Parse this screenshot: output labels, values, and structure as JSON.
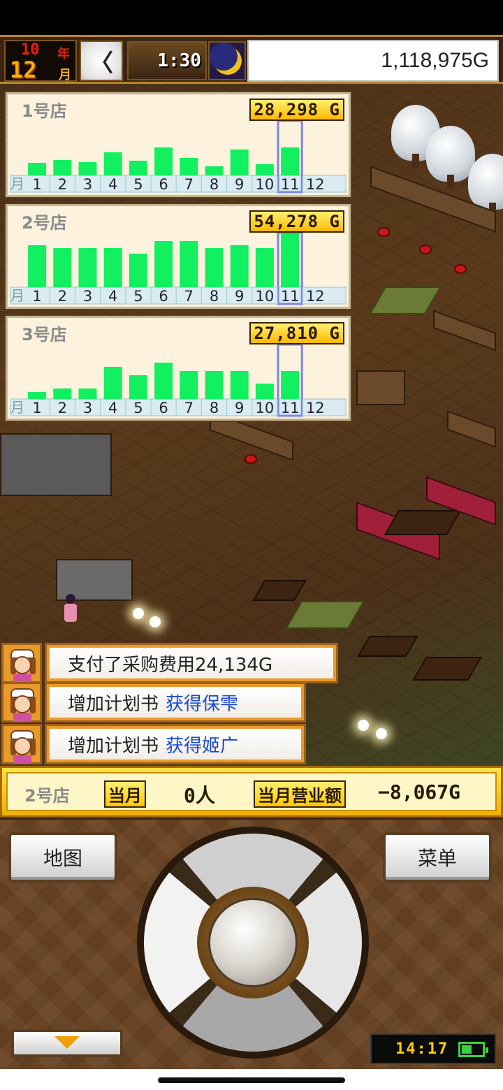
{
  "hud": {
    "year": "10",
    "year_unit": "年",
    "month": "12",
    "month_unit": "月",
    "clock_icon": "clock-back-icon",
    "clock_glyph": "〈",
    "time": "1:30",
    "moon_icon": "moon-icon",
    "money": "1,118,975G"
  },
  "chart_data": [
    {
      "type": "bar",
      "title": "1号店",
      "total": "28,298 G",
      "month_axis_label": "月",
      "categories": [
        "1",
        "2",
        "3",
        "4",
        "5",
        "6",
        "7",
        "8",
        "9",
        "10",
        "11",
        "12"
      ],
      "values": [
        18,
        22,
        19,
        33,
        21,
        40,
        25,
        13,
        37,
        16,
        40,
        null
      ],
      "highlight_index": 10,
      "bar_color": "#12f060"
    },
    {
      "type": "bar",
      "title": "2号店",
      "total": "54,278 G",
      "month_axis_label": "月",
      "categories": [
        "1",
        "2",
        "3",
        "4",
        "5",
        "6",
        "7",
        "8",
        "9",
        "10",
        "11",
        "12"
      ],
      "values": [
        60,
        56,
        56,
        56,
        48,
        66,
        66,
        56,
        60,
        56,
        78,
        null
      ],
      "highlight_index": 10,
      "bar_color": "#12f060"
    },
    {
      "type": "bar",
      "title": "3号店",
      "total": "27,810 G",
      "month_axis_label": "月",
      "categories": [
        "1",
        "2",
        "3",
        "4",
        "5",
        "6",
        "7",
        "8",
        "9",
        "10",
        "11",
        "12"
      ],
      "values": [
        10,
        15,
        15,
        46,
        34,
        52,
        40,
        40,
        40,
        22,
        40,
        null
      ],
      "highlight_index": 10,
      "bar_color": "#12f060"
    }
  ],
  "messages": [
    {
      "avatar_icon": "clerk-avatar-icon",
      "text": "支付了采购费用24,134G",
      "highlight": ""
    },
    {
      "avatar_icon": "clerk-avatar-icon",
      "text": "增加计划书",
      "highlight": "获得保雫"
    },
    {
      "avatar_icon": "clerk-avatar-icon",
      "text": "增加计划书",
      "highlight": "获得姬广"
    }
  ],
  "info_bar": {
    "store": "2号店",
    "month_label": "当月",
    "customers": "0人",
    "revenue_label": "当月营业额",
    "revenue": "−8,067G"
  },
  "controls": {
    "map_label": "地图",
    "menu_label": "菜单",
    "dpad_icon": "dpad-icon",
    "down_icon": "down-arrow-icon"
  },
  "system": {
    "clock": "14:17",
    "battery_icon": "battery-icon"
  },
  "colors": {
    "accent_gold": "#ffb800",
    "bar_green": "#12f060",
    "highlight_blue": "#1a4ad8",
    "frame_brown": "#3b2412"
  }
}
